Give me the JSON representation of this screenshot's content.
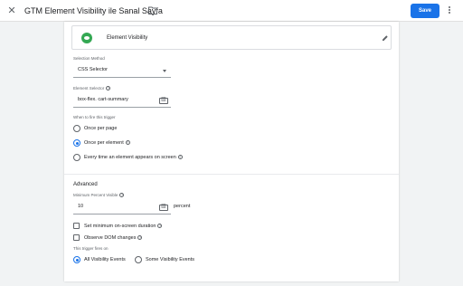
{
  "header": {
    "title": "GTM Element Visibility ile Sanal Sayfa",
    "save_label": "Save"
  },
  "trigger_type": {
    "label": "Element Visibility",
    "icon": "element-visibility-icon",
    "accent": "#34a853"
  },
  "selection_method": {
    "label": "Selection Method",
    "value": "CSS Selector"
  },
  "element_selector": {
    "label": "Element Selector",
    "value": "box-flex. cart-summary"
  },
  "fire_trigger": {
    "label": "When to fire this trigger",
    "options": [
      {
        "label": "Once per page",
        "selected": false
      },
      {
        "label": "Once per element",
        "selected": true
      },
      {
        "label": "Every time an element appears on screen",
        "selected": false
      }
    ]
  },
  "advanced": {
    "title": "Advanced",
    "min_percent_label": "Minimum Percent Visible",
    "min_percent_value": "10",
    "percent_suffix": "percent",
    "duration_label": "Set minimum on-screen duration",
    "dom_label": "Observe DOM changes"
  },
  "fires_on": {
    "label": "This trigger fires on",
    "options": [
      {
        "label": "All Visibility Events",
        "selected": true
      },
      {
        "label": "Some Visibility Events",
        "selected": false
      }
    ]
  },
  "colors": {
    "primary": "#1a73e8"
  }
}
